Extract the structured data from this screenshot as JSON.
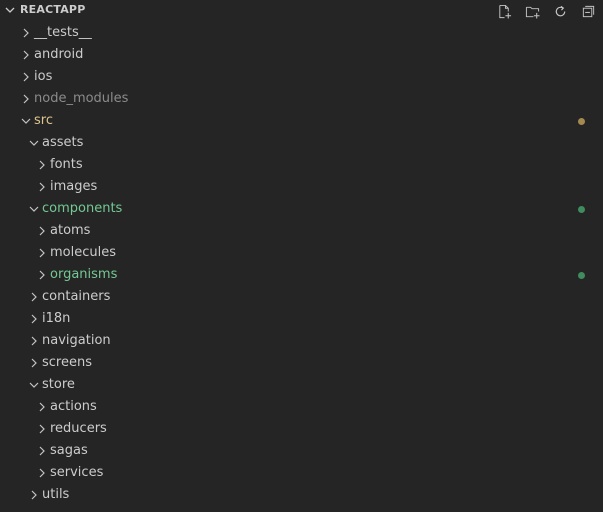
{
  "explorer": {
    "title": "REACTAPP",
    "actions": [
      {
        "name": "new-file-button",
        "icon": "new-file-icon"
      },
      {
        "name": "new-folder-button",
        "icon": "new-folder-icon"
      },
      {
        "name": "refresh-button",
        "icon": "refresh-icon"
      },
      {
        "name": "collapse-all-button",
        "icon": "collapse-all-icon"
      }
    ]
  },
  "colors": {
    "background": "#252526",
    "text": "#cccccc",
    "ignored": "#8b8b8b",
    "modified": "#dfc58d",
    "untracked": "#73c991",
    "modified_dot": "#a58a50",
    "untracked_dot": "#3f8c5e"
  },
  "tree": [
    {
      "label": "__tests__",
      "depth": 1,
      "expanded": false
    },
    {
      "label": "android",
      "depth": 1,
      "expanded": false
    },
    {
      "label": "ios",
      "depth": 1,
      "expanded": false
    },
    {
      "label": "node_modules",
      "depth": 1,
      "expanded": false,
      "status": "ignored"
    },
    {
      "label": "src",
      "depth": 1,
      "expanded": true,
      "status": "modified"
    },
    {
      "label": "assets",
      "depth": 2,
      "expanded": true
    },
    {
      "label": "fonts",
      "depth": 3,
      "expanded": false
    },
    {
      "label": "images",
      "depth": 3,
      "expanded": false
    },
    {
      "label": "components",
      "depth": 2,
      "expanded": true,
      "status": "untracked"
    },
    {
      "label": "atoms",
      "depth": 3,
      "expanded": false
    },
    {
      "label": "molecules",
      "depth": 3,
      "expanded": false
    },
    {
      "label": "organisms",
      "depth": 3,
      "expanded": false,
      "status": "untracked"
    },
    {
      "label": "containers",
      "depth": 2,
      "expanded": false
    },
    {
      "label": "i18n",
      "depth": 2,
      "expanded": false
    },
    {
      "label": "navigation",
      "depth": 2,
      "expanded": false
    },
    {
      "label": "screens",
      "depth": 2,
      "expanded": false
    },
    {
      "label": "store",
      "depth": 2,
      "expanded": true
    },
    {
      "label": "actions",
      "depth": 3,
      "expanded": false
    },
    {
      "label": "reducers",
      "depth": 3,
      "expanded": false
    },
    {
      "label": "sagas",
      "depth": 3,
      "expanded": false
    },
    {
      "label": "services",
      "depth": 3,
      "expanded": false
    },
    {
      "label": "utils",
      "depth": 2,
      "expanded": false
    }
  ]
}
